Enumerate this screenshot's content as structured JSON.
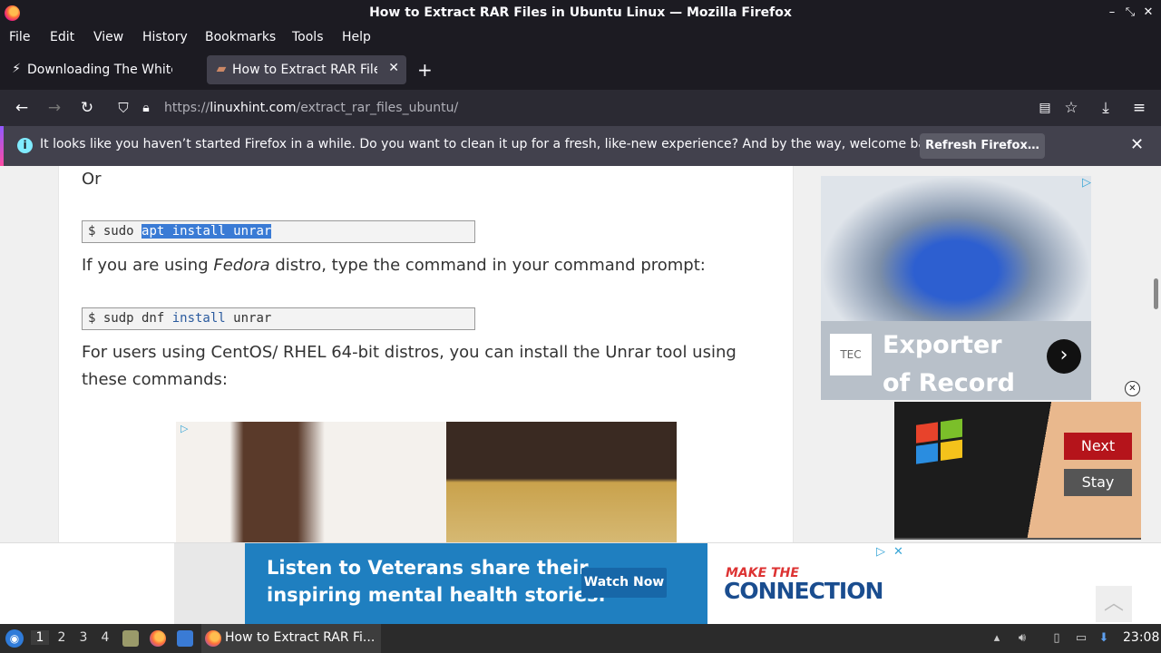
{
  "window": {
    "title": "How to Extract RAR Files in Ubuntu Linux — Mozilla Firefox"
  },
  "menu": [
    "File",
    "Edit",
    "View",
    "History",
    "Bookmarks",
    "Tools",
    "Help"
  ],
  "tabs": [
    {
      "label": "Downloading The White",
      "active": false,
      "icon": "lightning-icon"
    },
    {
      "label": "How to Extract RAR Files",
      "active": true,
      "icon": "site-icon"
    }
  ],
  "url": {
    "host": "linuxhint.com",
    "prefix": "https://",
    "path": "/extract_rar_files_ubuntu/"
  },
  "notification": {
    "message": "It looks like you haven’t started Firefox in a while. Do you want to clean it up for a fresh, like-new experience? And by the way, welcome back!",
    "button": "Refresh Firefox…"
  },
  "article": {
    "or": "Or",
    "cmd1": {
      "prompt": "$ sudo ",
      "selected": "apt install unrar"
    },
    "fedora_text_pre": "If you are using ",
    "fedora_word": "Fedora",
    "fedora_text_post": " distro, type the command in your command prompt:",
    "cmd2": {
      "prompt": "$ sudp dnf ",
      "keyword": "install",
      "rest": " unrar"
    },
    "centos_line1": "For users using CentOS/ RHEL 64-bit distros, you can install the Unrar tool using",
    "centos_line2": "these commands:"
  },
  "side_ad": {
    "logo": "TEC",
    "headline": "Exporter of Record"
  },
  "video_ad": {
    "next": "Next",
    "stay": "Stay"
  },
  "bottom_ad": {
    "line1": "Listen to Veterans share their",
    "line2": "inspiring mental health stories.",
    "button": "Watch Now",
    "brand_top": "MAKE THE",
    "brand_bottom": "CONNECTION"
  },
  "taskbar": {
    "workspaces": [
      "1",
      "2",
      "3",
      "4"
    ],
    "active_workspace": 0,
    "task_label": "How to Extract RAR Fi...",
    "clock": "23:08"
  },
  "colors": {
    "accent": "#3a7bd5",
    "firefox_dark": "#1c1b22",
    "ad_blue": "#1f7fc0"
  }
}
